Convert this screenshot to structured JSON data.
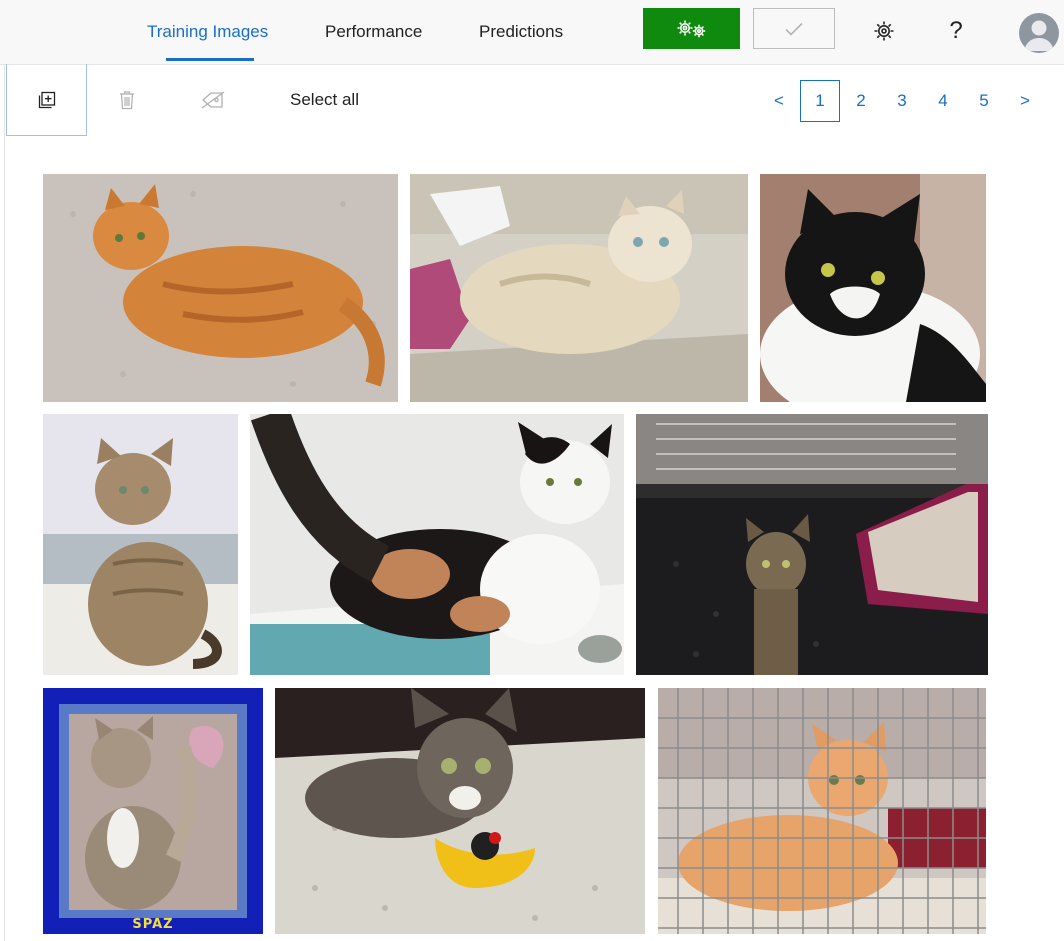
{
  "tabs": [
    {
      "label": "Training Images",
      "active": true
    },
    {
      "label": "Performance",
      "active": false
    },
    {
      "label": "Predictions",
      "active": false
    }
  ],
  "header": {
    "train_button_icon": "gears-icon",
    "quick_test_icon": "checkmark-icon",
    "settings_icon": "gear-icon",
    "help_label": "?",
    "avatar_icon": "user-avatar"
  },
  "toolbar": {
    "add_icon": "add-images-icon",
    "delete_icon": "trash-icon",
    "tag_icon": "tag-icon",
    "select_all": "Select all"
  },
  "pagination": {
    "prev": "<",
    "pages": [
      "1",
      "2",
      "3",
      "4",
      "5"
    ],
    "current": "1",
    "next": ">"
  },
  "gallery": {
    "caption_spaz": "SPAZ"
  },
  "colors": {
    "accent": "#1a6fc4",
    "train_button": "#0f8a0f"
  }
}
